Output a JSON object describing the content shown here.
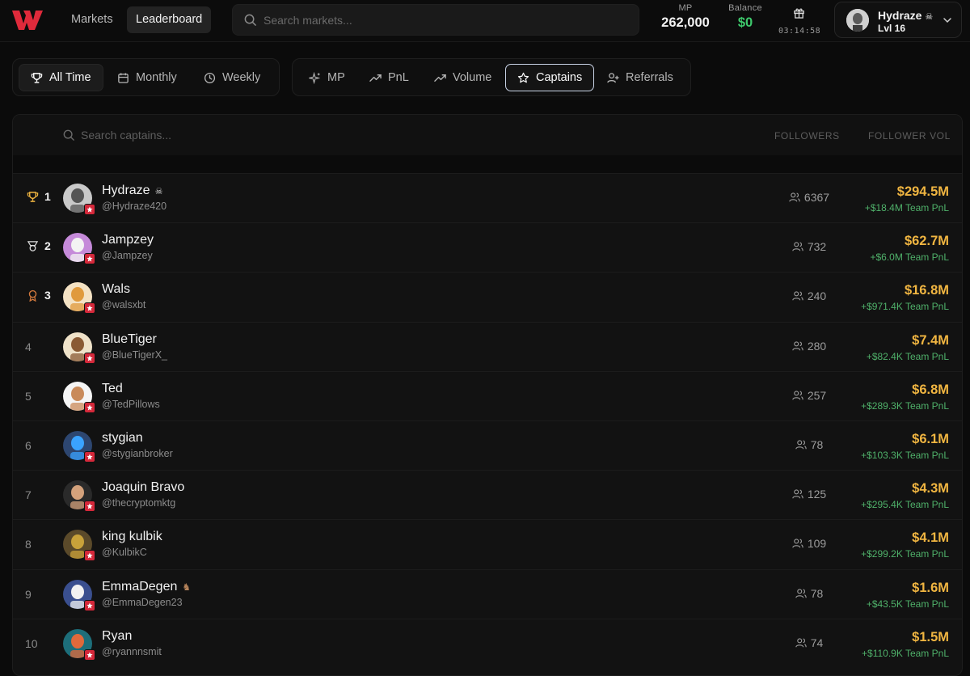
{
  "header": {
    "nav": [
      "Markets",
      "Leaderboard"
    ],
    "search_placeholder": "Search markets...",
    "mp_label": "MP",
    "mp_value": "262,000",
    "balance_label": "Balance",
    "balance_value": "$0",
    "timer": "03:14:58",
    "user": {
      "name": "Hydraze",
      "level": "Lvl 16"
    }
  },
  "time_filters": [
    "All Time",
    "Monthly",
    "Weekly"
  ],
  "category_filters": [
    "MP",
    "PnL",
    "Volume",
    "Captains",
    "Referrals"
  ],
  "table": {
    "search_placeholder": "Search captains...",
    "col_followers": "Followers",
    "col_volume": "Follower Vol",
    "rows": [
      {
        "rank": "1",
        "name": "Hydraze",
        "handle": "@Hydraze420",
        "followers": "6367",
        "volume": "$294.5M",
        "pnl": "+$18.4M Team PnL"
      },
      {
        "rank": "2",
        "name": "Jampzey",
        "handle": "@Jampzey",
        "followers": "732",
        "volume": "$62.7M",
        "pnl": "+$6.0M Team PnL"
      },
      {
        "rank": "3",
        "name": "Wals",
        "handle": "@walsxbt",
        "followers": "240",
        "volume": "$16.8M",
        "pnl": "+$971.4K Team PnL"
      },
      {
        "rank": "4",
        "name": "BlueTiger",
        "handle": "@BlueTigerX_",
        "followers": "280",
        "volume": "$7.4M",
        "pnl": "+$82.4K Team PnL"
      },
      {
        "rank": "5",
        "name": "Ted",
        "handle": "@TedPillows",
        "followers": "257",
        "volume": "$6.8M",
        "pnl": "+$289.3K Team PnL"
      },
      {
        "rank": "6",
        "name": "stygian",
        "handle": "@stygianbroker",
        "followers": "78",
        "volume": "$6.1M",
        "pnl": "+$103.3K Team PnL"
      },
      {
        "rank": "7",
        "name": "Joaquin Bravo",
        "handle": "@thecryptomktg",
        "followers": "125",
        "volume": "$4.3M",
        "pnl": "+$295.4K Team PnL"
      },
      {
        "rank": "8",
        "name": "king kulbik",
        "handle": "@KulbikC",
        "followers": "109",
        "volume": "$4.1M",
        "pnl": "+$299.2K Team PnL"
      },
      {
        "rank": "9",
        "name": "EmmaDegen",
        "handle": "@EmmaDegen23",
        "followers": "78",
        "volume": "$1.6M",
        "pnl": "+$43.5K Team PnL"
      },
      {
        "rank": "10",
        "name": "Ryan",
        "handle": "@ryannnsmit",
        "followers": "74",
        "volume": "$1.5M",
        "pnl": "+$110.9K Team PnL"
      }
    ]
  },
  "colors": {
    "brand": "#e02a3b",
    "volume": "#f0b541",
    "pnl": "#4fb16a",
    "balance": "#3ec96c",
    "badge": "#d5283a"
  }
}
